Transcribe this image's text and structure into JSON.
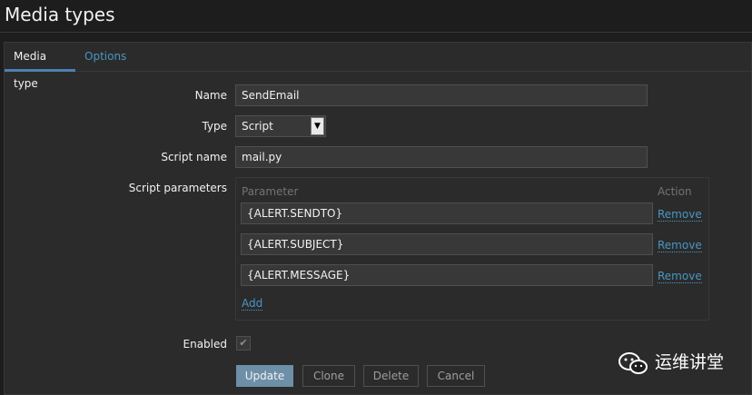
{
  "header": {
    "title": "Media types"
  },
  "tabs": [
    {
      "label": "Media type",
      "active": true
    },
    {
      "label": "Options",
      "active": false
    }
  ],
  "form": {
    "name": {
      "label": "Name",
      "value": "SendEmail"
    },
    "type": {
      "label": "Type",
      "value": "Script"
    },
    "script_name": {
      "label": "Script name",
      "value": "mail.py"
    },
    "script_parameters": {
      "label": "Script parameters",
      "col_parameter": "Parameter",
      "col_action": "Action",
      "rows": [
        {
          "value": "{ALERT.SENDTO}",
          "action": "Remove"
        },
        {
          "value": "{ALERT.SUBJECT}",
          "action": "Remove"
        },
        {
          "value": "{ALERT.MESSAGE}",
          "action": "Remove"
        }
      ],
      "add_label": "Add"
    },
    "enabled": {
      "label": "Enabled",
      "checked": true
    }
  },
  "buttons": {
    "update": "Update",
    "clone": "Clone",
    "delete": "Delete",
    "cancel": "Cancel"
  },
  "watermark": {
    "text": "运维讲堂",
    "icon": "wechat-icon"
  },
  "colors": {
    "background": "#1d1d1d",
    "panel": "#2b2b2b",
    "link": "#4796c4",
    "primary_button": "#6d8fa8",
    "tab_underline": "#4f7fb0"
  }
}
